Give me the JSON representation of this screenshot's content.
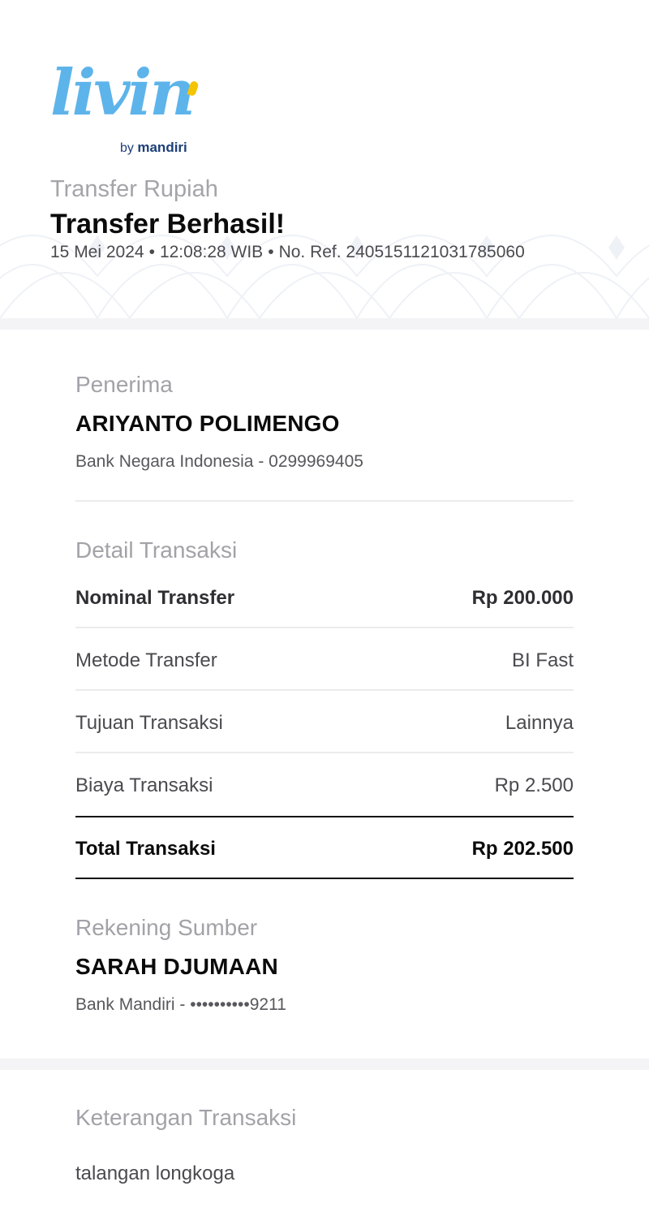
{
  "brand": {
    "wordmark": "livin",
    "by": "by",
    "sub": "mandiri",
    "colors": {
      "primary": "#5db4ea",
      "accent": "#f5c400",
      "navy": "#1d3f78"
    }
  },
  "header": {
    "category": "Transfer Rupiah",
    "title": "Transfer Berhasil!",
    "date": "15 Mei 2024",
    "time": "12:08:28 WIB",
    "ref": "No. Ref. 2405151121031785060",
    "separator": "•"
  },
  "recipient": {
    "label": "Penerima",
    "name": "ARIYANTO POLIMENGO",
    "account": "Bank Negara Indonesia - 0299969405"
  },
  "details": {
    "label": "Detail Transaksi",
    "rows": [
      {
        "key": "Nominal Transfer",
        "value": "Rp 200.000"
      },
      {
        "key": "Metode Transfer",
        "value": "BI Fast"
      },
      {
        "key": "Tujuan Transaksi",
        "value": "Lainnya"
      },
      {
        "key": "Biaya Transaksi",
        "value": "Rp 2.500"
      }
    ],
    "total": {
      "key": "Total Transaksi",
      "value": "Rp 202.500"
    }
  },
  "source": {
    "label": "Rekening Sumber",
    "name": "SARAH DJUMAAN",
    "account": "Bank Mandiri - ••••••••••9211"
  },
  "note": {
    "label": "Keterangan Transaksi",
    "text": "talangan longkoga"
  }
}
